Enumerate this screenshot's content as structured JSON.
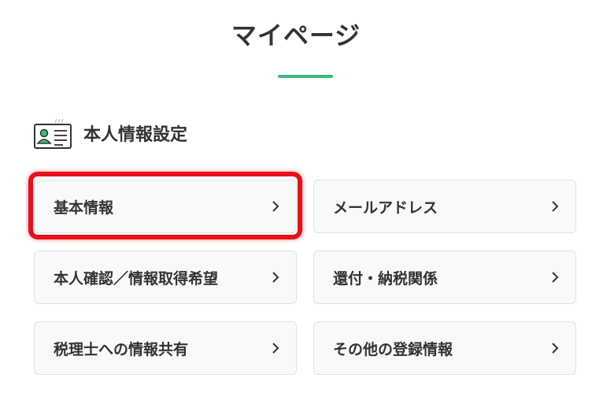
{
  "page": {
    "title": "マイページ",
    "accent_color": "#3dbb7a"
  },
  "section": {
    "title": "本人情報設定",
    "icon": "id-card-icon"
  },
  "cards": [
    {
      "label": "基本情報",
      "icon": "chevron-right-icon",
      "highlighted": true
    },
    {
      "label": "メールアドレス",
      "icon": "chevron-right-icon"
    },
    {
      "label": "本人確認／情報取得希望",
      "icon": "chevron-right-icon"
    },
    {
      "label": "還付・納税関係",
      "icon": "chevron-right-icon"
    },
    {
      "label": "税理士への情報共有",
      "icon": "chevron-right-icon"
    },
    {
      "label": "その他の登録情報",
      "icon": "chevron-right-icon"
    }
  ],
  "highlight_color": "#e8101b"
}
